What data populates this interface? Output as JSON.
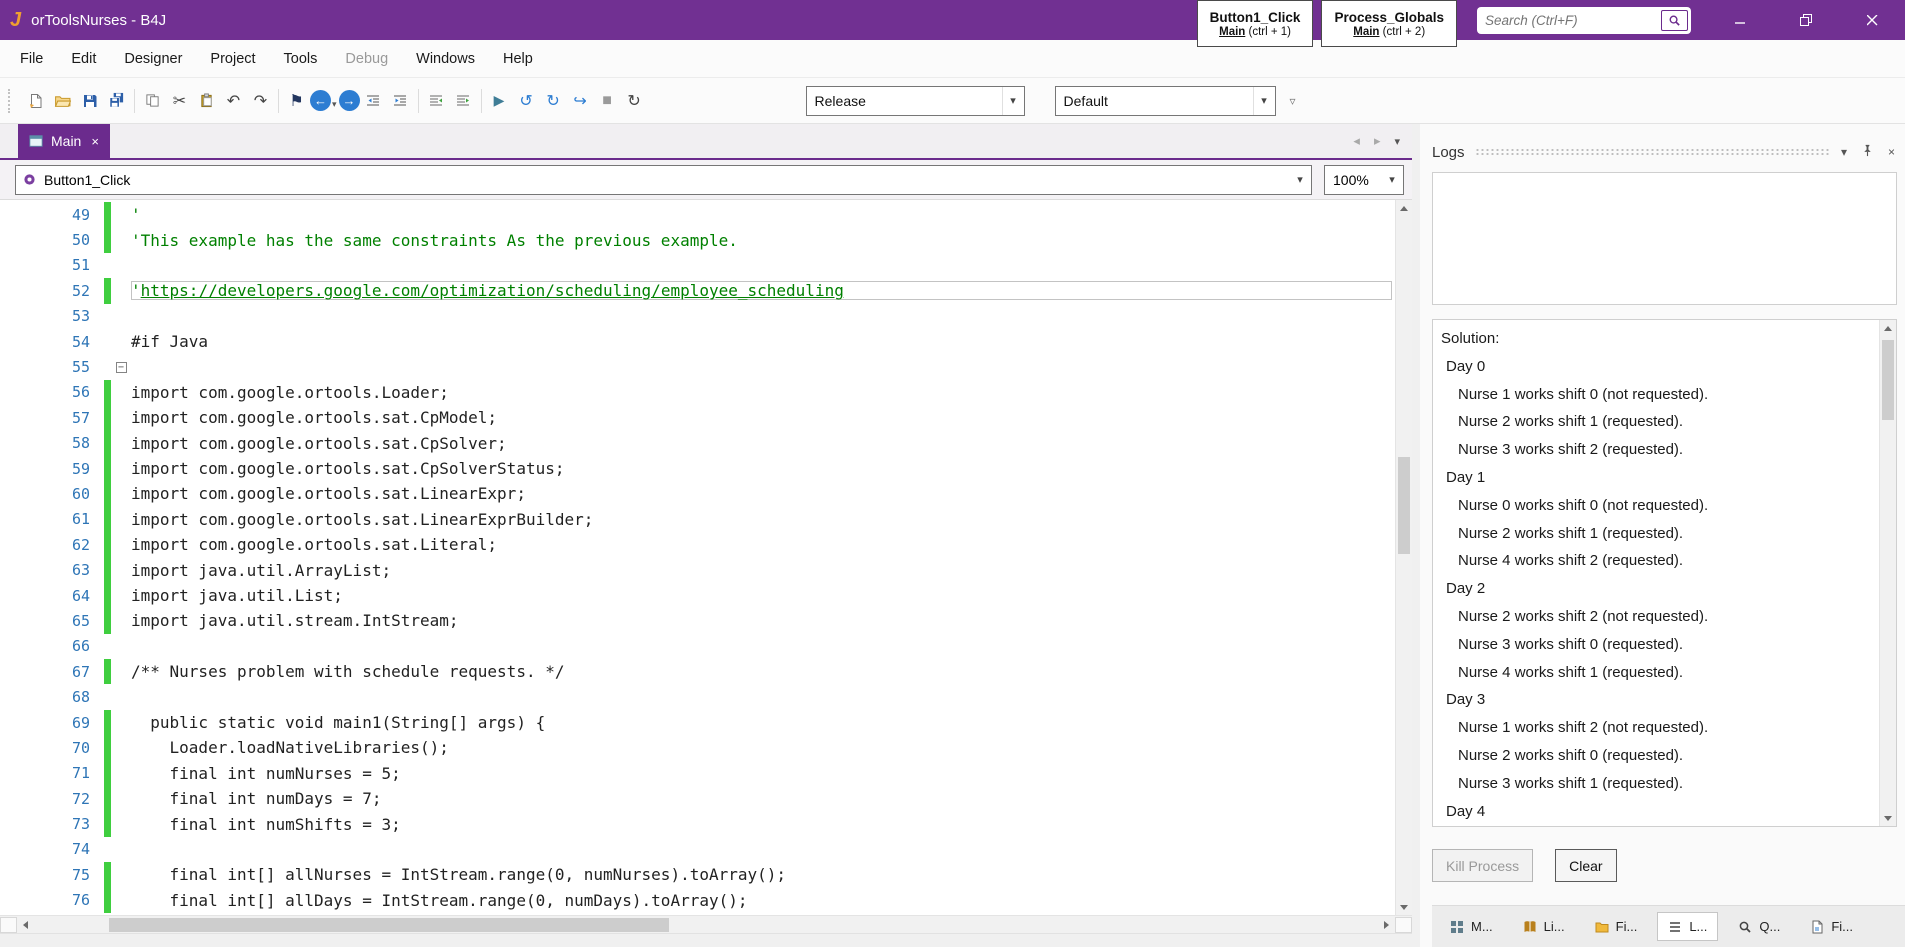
{
  "colors": {
    "accent": "#6B2B8D",
    "titlebar": "#713092",
    "comment": "#008000",
    "linenum": "#2E75B6",
    "changebar": "#3FCE3F"
  },
  "window": {
    "logo": "J",
    "title": "orToolsNurses - B4J"
  },
  "titlebar": {
    "quick_tabs": [
      {
        "name": "Button1_Click",
        "target": "Main",
        "shortcut": " (ctrl + 1)"
      },
      {
        "name": "Process_Globals",
        "target": "Main",
        "shortcut": " (ctrl + 2)"
      }
    ],
    "search_placeholder": "Search (Ctrl+F)"
  },
  "menu": [
    "File",
    "Edit",
    "Designer",
    "Project",
    "Tools",
    "Debug",
    "Windows",
    "Help"
  ],
  "toolbar": {
    "build_config": "Release",
    "deploy_config": "Default"
  },
  "editor": {
    "tab_label": "Main",
    "member_selector": "Button1_Click",
    "zoom": "100%",
    "lines": [
      {
        "n": 49,
        "changed": true,
        "segs": [
          {
            "t": "'",
            "c": "comment"
          }
        ]
      },
      {
        "n": 50,
        "changed": true,
        "segs": [
          {
            "t": "'This example has the same constraints As the previous example.",
            "c": "comment"
          }
        ]
      },
      {
        "n": 51,
        "changed": false,
        "segs": []
      },
      {
        "n": 52,
        "changed": true,
        "current": true,
        "segs": [
          {
            "t": "'",
            "c": "comment"
          },
          {
            "t": "https://developers.google.com/optimization/scheduling/employee_scheduling",
            "c": "comment link"
          }
        ]
      },
      {
        "n": 53,
        "changed": false,
        "segs": []
      },
      {
        "n": 54,
        "changed": false,
        "segs": [
          {
            "t": "#if Java",
            "c": "plain"
          }
        ]
      },
      {
        "n": 55,
        "changed": false,
        "collapse": true,
        "segs": []
      },
      {
        "n": 56,
        "changed": true,
        "segs": [
          {
            "t": "import com.google.ortools.Loader;",
            "c": "plain"
          }
        ]
      },
      {
        "n": 57,
        "changed": true,
        "segs": [
          {
            "t": "import com.google.ortools.sat.CpModel;",
            "c": "plain"
          }
        ]
      },
      {
        "n": 58,
        "changed": true,
        "segs": [
          {
            "t": "import com.google.ortools.sat.CpSolver;",
            "c": "plain"
          }
        ]
      },
      {
        "n": 59,
        "changed": true,
        "segs": [
          {
            "t": "import com.google.ortools.sat.CpSolverStatus;",
            "c": "plain"
          }
        ]
      },
      {
        "n": 60,
        "changed": true,
        "segs": [
          {
            "t": "import com.google.ortools.sat.LinearExpr;",
            "c": "plain"
          }
        ]
      },
      {
        "n": 61,
        "changed": true,
        "segs": [
          {
            "t": "import com.google.ortools.sat.LinearExprBuilder;",
            "c": "plain"
          }
        ]
      },
      {
        "n": 62,
        "changed": true,
        "segs": [
          {
            "t": "import com.google.ortools.sat.Literal;",
            "c": "plain"
          }
        ]
      },
      {
        "n": 63,
        "changed": true,
        "segs": [
          {
            "t": "import java.util.ArrayList;",
            "c": "plain"
          }
        ]
      },
      {
        "n": 64,
        "changed": true,
        "segs": [
          {
            "t": "import java.util.List;",
            "c": "plain"
          }
        ]
      },
      {
        "n": 65,
        "changed": true,
        "segs": [
          {
            "t": "import java.util.stream.IntStream;",
            "c": "plain"
          }
        ]
      },
      {
        "n": 66,
        "changed": false,
        "segs": []
      },
      {
        "n": 67,
        "changed": true,
        "segs": [
          {
            "t": "/** Nurses problem with schedule requests. */",
            "c": "plain"
          }
        ]
      },
      {
        "n": 68,
        "changed": false,
        "segs": []
      },
      {
        "n": 69,
        "changed": true,
        "segs": [
          {
            "t": "  public static void main1(String[] args) {",
            "c": "plain"
          }
        ]
      },
      {
        "n": 70,
        "changed": true,
        "segs": [
          {
            "t": "    Loader.loadNativeLibraries();",
            "c": "plain"
          }
        ]
      },
      {
        "n": 71,
        "changed": true,
        "segs": [
          {
            "t": "    final int numNurses = 5;",
            "c": "plain"
          }
        ]
      },
      {
        "n": 72,
        "changed": true,
        "segs": [
          {
            "t": "    final int numDays = 7;",
            "c": "plain"
          }
        ]
      },
      {
        "n": 73,
        "changed": true,
        "segs": [
          {
            "t": "    final int numShifts = 3;",
            "c": "plain"
          }
        ]
      },
      {
        "n": 74,
        "changed": false,
        "segs": []
      },
      {
        "n": 75,
        "changed": true,
        "segs": [
          {
            "t": "    final int[] allNurses = IntStream.range(0, numNurses).toArray();",
            "c": "plain"
          }
        ]
      },
      {
        "n": 76,
        "changed": true,
        "segs": [
          {
            "t": "    final int[] allDays = IntStream.range(0, numDays).toArray();",
            "c": "plain"
          }
        ]
      }
    ]
  },
  "logs": {
    "title": "Logs",
    "kill_label": "Kill Process",
    "clear_label": "Clear",
    "solution_lines": [
      {
        "text": "Solution:",
        "indent": 0
      },
      {
        "text": "Day 0",
        "indent": 1
      },
      {
        "text": "Nurse 1 works shift 0 (not requested).",
        "indent": 2
      },
      {
        "text": "Nurse 2 works shift 1 (requested).",
        "indent": 2
      },
      {
        "text": "Nurse 3 works shift 2 (requested).",
        "indent": 2
      },
      {
        "text": "Day 1",
        "indent": 1
      },
      {
        "text": "Nurse 0 works shift 0 (not requested).",
        "indent": 2
      },
      {
        "text": "Nurse 2 works shift 1 (requested).",
        "indent": 2
      },
      {
        "text": "Nurse 4 works shift 2 (requested).",
        "indent": 2
      },
      {
        "text": "Day 2",
        "indent": 1
      },
      {
        "text": "Nurse 2 works shift 2 (not requested).",
        "indent": 2
      },
      {
        "text": "Nurse 3 works shift 0 (requested).",
        "indent": 2
      },
      {
        "text": "Nurse 4 works shift 1 (requested).",
        "indent": 2
      },
      {
        "text": "Day 3",
        "indent": 1
      },
      {
        "text": "Nurse 1 works shift 2 (not requested).",
        "indent": 2
      },
      {
        "text": "Nurse 2 works shift 0 (requested).",
        "indent": 2
      },
      {
        "text": "Nurse 3 works shift 1 (requested).",
        "indent": 2
      },
      {
        "text": "Day 4",
        "indent": 1
      }
    ]
  },
  "bottom_tabs": [
    {
      "label": "M..."
    },
    {
      "label": "Li..."
    },
    {
      "label": "Fi..."
    },
    {
      "label": "L..."
    },
    {
      "label": "Q..."
    },
    {
      "label": "Fi..."
    }
  ],
  "icons": {
    "close": "×",
    "chevron_down": "▾",
    "chevron_small": "▿",
    "cut": "✂",
    "undo": "↶",
    "redo": "↷",
    "bookmark": "⚑",
    "back": "←",
    "forward": "→",
    "run": "▶",
    "stop": "■",
    "step_over": "↺",
    "step_into": "↻",
    "resume": "↪",
    "restart": "↻",
    "tab_prev": "◂",
    "tab_next": "▸",
    "collapse": "−"
  }
}
